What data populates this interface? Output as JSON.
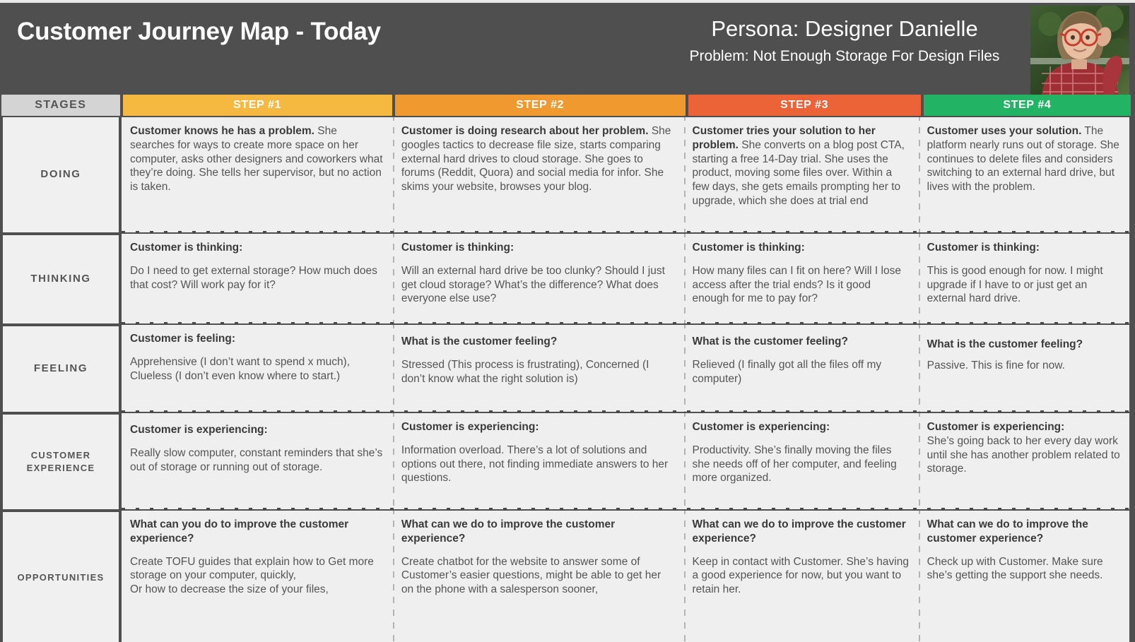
{
  "header": {
    "map_title": "Customer Journey Map - Today",
    "persona_title": "Persona: Designer Danielle",
    "persona_problem": "Problem: Not Enough Storage For Design Files",
    "photo_alt": "persona-photo-woman-with-glasses"
  },
  "colors": {
    "background": "#4f4f4f",
    "stages_header": "#d4d4d4",
    "step1": "#f5b942",
    "step2": "#f0992e",
    "step3": "#ec6337",
    "step4": "#22b464",
    "cell_background": "#efefef",
    "title_text": "#3a3a3a",
    "body_text": "#555555"
  },
  "columns": {
    "stages_label": "STAGES",
    "steps": [
      {
        "label": "STEP #1",
        "color": "#f5b942"
      },
      {
        "label": "STEP #2",
        "color": "#f0992e"
      },
      {
        "label": "STEP #3",
        "color": "#ec6337"
      },
      {
        "label": "STEP #4",
        "color": "#22b464"
      }
    ]
  },
  "rows": [
    {
      "stage": "DOING",
      "cells": [
        {
          "lead": "Customer knows he has a problem.",
          "text": " She searches for ways to create more space on her computer, asks other designers and coworkers what they’re doing. She tells her supervisor, but no action is taken."
        },
        {
          "lead": "Customer is doing research about her problem.",
          "text": " She googles tactics to decrease file size, starts comparing external hard drives to cloud storage. She goes to forums (Reddit, Quora) and social media for infor. She skims your website, browses your blog."
        },
        {
          "lead": "Customer tries your solution to her problem.",
          "text": " She converts on a blog post CTA, starting a free 14-Day trial. She uses the product, moving some files over. Within a few days, she gets emails prompting her to upgrade, which she does at trial end"
        },
        {
          "lead": "Customer uses your solution.",
          "text": " The platform nearly runs out of storage. She continues to delete files and considers switching to an external hard drive, but lives with the problem."
        }
      ]
    },
    {
      "stage": "THINKING",
      "cells": [
        {
          "title": "Customer is thinking:",
          "body": "Do I need to get external storage? How much does that cost? Will work pay for it?"
        },
        {
          "title": "Customer is thinking:",
          "body": "Will an external hard drive be too clunky? Should I just get cloud storage? What’s the difference? What does everyone else use?"
        },
        {
          "title": "Customer is thinking:",
          "body": "How many files can I fit on here? Will I lose access after the trial ends? Is it good enough for me to pay for?"
        },
        {
          "title": "Customer is thinking:",
          "body": "This is good enough for now. I might upgrade if I have to or just get an external hard drive."
        }
      ]
    },
    {
      "stage": "FEELING",
      "cells": [
        {
          "title": "Customer is feeling:",
          "body": "Apprehensive (I don’t want to spend x much), Clueless (I don’t even know where to start.)"
        },
        {
          "title": "What is the customer feeling?",
          "body": "Stressed (This process is frustrating), Concerned (I don’t know what the right solution is)"
        },
        {
          "title": "What is the customer feeling?",
          "body": "Relieved (I finally got all the files off my computer)"
        },
        {
          "title": "What is the customer feeling?",
          "body": "Passive. This is fine for now."
        }
      ]
    },
    {
      "stage": "CUSTOMER EXPERIENCE",
      "cells": [
        {
          "title": "Customer is experiencing:",
          "body": "Really slow computer, constant reminders that she’s out of storage or running out of storage."
        },
        {
          "title": "Customer is experiencing:",
          "body": "Information overload. There’s a lot of solutions and options out there, not finding immediate answers to her questions."
        },
        {
          "title": "Customer is experiencing:",
          "body": "Productivity. She’s finally moving the files she needs off of her computer, and feeling more organized."
        },
        {
          "title": "Customer is experiencing:",
          "body": "She’s going back to her every day work until she has another problem related to storage."
        }
      ]
    },
    {
      "stage": "OPPORTUNITIES",
      "cells": [
        {
          "title": "What can you do to improve the customer experience?",
          "body": "Create TOFU guides that explain how to Get more storage on your computer, quickly,\nOr how to decrease the size of your files,"
        },
        {
          "title": "What can we do to improve the customer experience?",
          "body": "Create chatbot for the website to answer some of Customer’s easier questions, might be able to get her on the phone with a salesperson sooner,"
        },
        {
          "title": "What can we do to improve the customer experience?",
          "body": "Keep in contact with Customer. She’s having a good experience for now, but you want to retain her."
        },
        {
          "title": "What can we do to improve the customer experience?",
          "body": "Check up with Customer. Make sure she’s getting the support she needs."
        }
      ]
    }
  ]
}
